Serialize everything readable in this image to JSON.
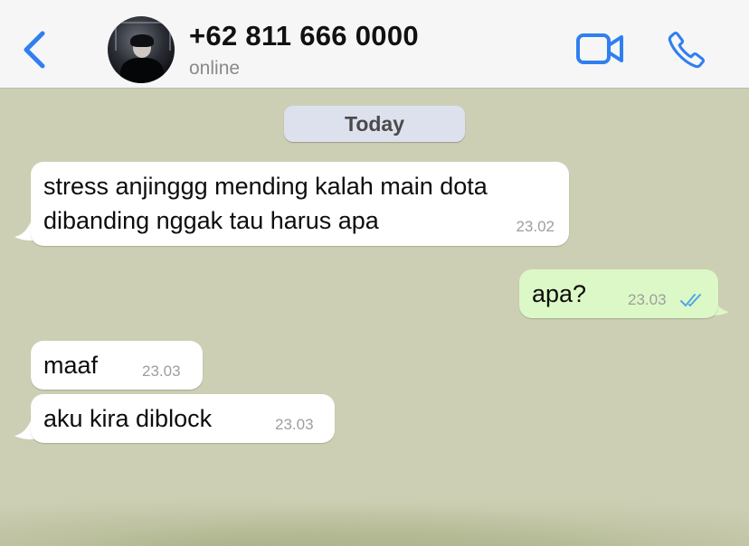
{
  "header": {
    "contact_name": "+62 811 666 0000",
    "status": "online"
  },
  "icons": {
    "back": "chevron-left-icon",
    "video": "video-camera-icon",
    "call": "phone-icon"
  },
  "colors": {
    "accent": "#2f7ff0",
    "chat_background": "#cdcfb4",
    "incoming_bubble": "#ffffff",
    "outgoing_bubble": "#dcf8c6",
    "read_ticks": "#4fa6e8"
  },
  "date_separator": "Today",
  "messages": [
    {
      "direction": "incoming",
      "lines": [
        "stress anjinggg mending kalah main dota",
        "dibanding nggak tau harus apa"
      ],
      "time": "23.02"
    },
    {
      "direction": "outgoing",
      "lines": [
        "apa?"
      ],
      "time": "23.03",
      "status": "read"
    },
    {
      "direction": "incoming",
      "lines": [
        "maaf"
      ],
      "time": "23.03"
    },
    {
      "direction": "incoming",
      "lines": [
        "aku kira diblock"
      ],
      "time": "23.03"
    }
  ]
}
